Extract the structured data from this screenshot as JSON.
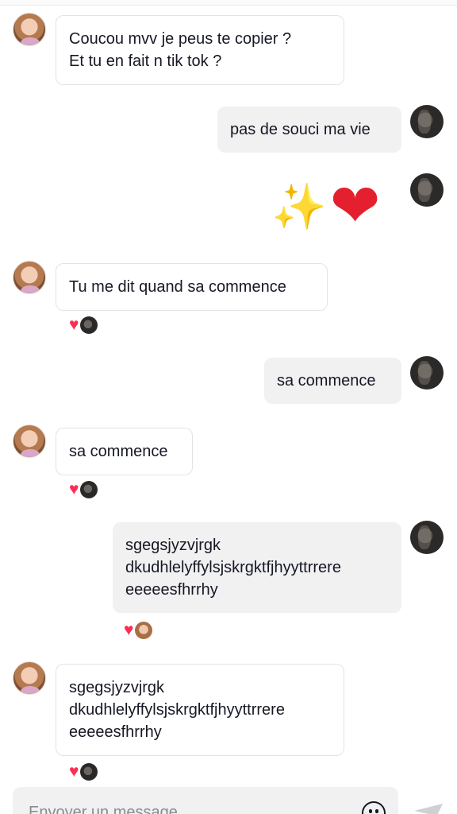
{
  "messages": [
    {
      "id": "m1",
      "side": "in",
      "text": "Coucou mvv je peus te copier ?\nEt tu en fait n tik tok ?",
      "reaction": null
    },
    {
      "id": "m2",
      "side": "out",
      "text": "pas de souci ma vie",
      "reaction": null
    },
    {
      "id": "m3",
      "side": "out",
      "type": "emoji",
      "emojis": [
        "sparkles-icon",
        "heart-icon"
      ],
      "reaction": null
    },
    {
      "id": "m4",
      "side": "in",
      "text": "Tu me dit quand sa commence",
      "reaction": {
        "icon": "heart-icon",
        "by": "other"
      }
    },
    {
      "id": "m5",
      "side": "out",
      "text": "sa commence",
      "reaction": null
    },
    {
      "id": "m6",
      "side": "in",
      "text": "sa commence",
      "reaction": {
        "icon": "heart-icon",
        "by": "other"
      }
    },
    {
      "id": "m7",
      "side": "out",
      "text": "sgegsjyzvjrgk\ndkudhlelyffylsjskrgktfjhyyttrrere\neeeeesfhrrhy",
      "reaction": {
        "icon": "heart-icon",
        "by": "other"
      }
    },
    {
      "id": "m8",
      "side": "in",
      "text": "sgegsjyzvjrgk\ndkudhlelyffylsjskrgktfjhyyttrrere\neeeeesfhrrhy",
      "reaction": {
        "icon": "heart-icon",
        "by": "other"
      }
    }
  ],
  "composer": {
    "placeholder": "Envoyer un message",
    "emoji_icon": "smiley-icon",
    "send_icon": "send-icon"
  },
  "colors": {
    "reaction_heart": "#fe2c55",
    "outgoing_bubble": "#f1f1f2",
    "incoming_border": "#e3e3e4"
  }
}
